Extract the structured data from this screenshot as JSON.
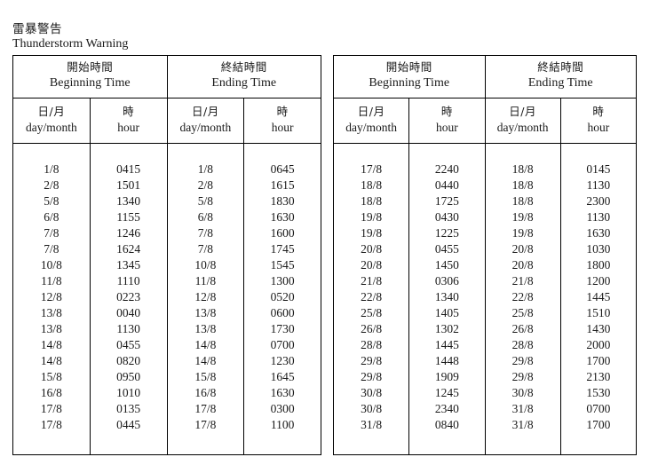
{
  "document": {
    "title_zh": "雷暴警告",
    "title_en": "Thunderstorm Warning"
  },
  "headers": {
    "beginning_zh": "開始時間",
    "beginning_en": "Beginning Time",
    "ending_zh": "終結時間",
    "ending_en": "Ending Time",
    "daymonth_zh": "日/月",
    "daymonth_en": "day/month",
    "hour_zh": "時",
    "hour_en": "hour"
  },
  "tables": [
    {
      "name": "left-table",
      "columns": [
        "begin_date",
        "begin_hour",
        "end_date",
        "end_hour"
      ],
      "rows": [
        {
          "begin_date": "1/8",
          "begin_hour": "0415",
          "end_date": "1/8",
          "end_hour": "0645"
        },
        {
          "begin_date": "2/8",
          "begin_hour": "1501",
          "end_date": "2/8",
          "end_hour": "1615"
        },
        {
          "begin_date": "5/8",
          "begin_hour": "1340",
          "end_date": "5/8",
          "end_hour": "1830"
        },
        {
          "begin_date": "6/8",
          "begin_hour": "1155",
          "end_date": "6/8",
          "end_hour": "1630"
        },
        {
          "begin_date": "7/8",
          "begin_hour": "1246",
          "end_date": "7/8",
          "end_hour": "1600"
        },
        {
          "begin_date": "7/8",
          "begin_hour": "1624",
          "end_date": "7/8",
          "end_hour": "1745"
        },
        {
          "begin_date": "10/8",
          "begin_hour": "1345",
          "end_date": "10/8",
          "end_hour": "1545"
        },
        {
          "begin_date": "11/8",
          "begin_hour": "1110",
          "end_date": "11/8",
          "end_hour": "1300"
        },
        {
          "begin_date": "12/8",
          "begin_hour": "0223",
          "end_date": "12/8",
          "end_hour": "0520"
        },
        {
          "begin_date": "13/8",
          "begin_hour": "0040",
          "end_date": "13/8",
          "end_hour": "0600"
        },
        {
          "begin_date": "13/8",
          "begin_hour": "1130",
          "end_date": "13/8",
          "end_hour": "1730"
        },
        {
          "begin_date": "14/8",
          "begin_hour": "0455",
          "end_date": "14/8",
          "end_hour": "0700"
        },
        {
          "begin_date": "14/8",
          "begin_hour": "0820",
          "end_date": "14/8",
          "end_hour": "1230"
        },
        {
          "begin_date": "15/8",
          "begin_hour": "0950",
          "end_date": "15/8",
          "end_hour": "1645"
        },
        {
          "begin_date": "16/8",
          "begin_hour": "1010",
          "end_date": "16/8",
          "end_hour": "1630"
        },
        {
          "begin_date": "17/8",
          "begin_hour": "0135",
          "end_date": "17/8",
          "end_hour": "0300"
        },
        {
          "begin_date": "17/8",
          "begin_hour": "0445",
          "end_date": "17/8",
          "end_hour": "1100"
        }
      ]
    },
    {
      "name": "right-table",
      "columns": [
        "begin_date",
        "begin_hour",
        "end_date",
        "end_hour"
      ],
      "rows": [
        {
          "begin_date": "17/8",
          "begin_hour": "2240",
          "end_date": "18/8",
          "end_hour": "0145"
        },
        {
          "begin_date": "18/8",
          "begin_hour": "0440",
          "end_date": "18/8",
          "end_hour": "1130"
        },
        {
          "begin_date": "18/8",
          "begin_hour": "1725",
          "end_date": "18/8",
          "end_hour": "2300"
        },
        {
          "begin_date": "19/8",
          "begin_hour": "0430",
          "end_date": "19/8",
          "end_hour": "1130"
        },
        {
          "begin_date": "19/8",
          "begin_hour": "1225",
          "end_date": "19/8",
          "end_hour": "1630"
        },
        {
          "begin_date": "20/8",
          "begin_hour": "0455",
          "end_date": "20/8",
          "end_hour": "1030"
        },
        {
          "begin_date": "20/8",
          "begin_hour": "1450",
          "end_date": "20/8",
          "end_hour": "1800"
        },
        {
          "begin_date": "21/8",
          "begin_hour": "0306",
          "end_date": "21/8",
          "end_hour": "1200"
        },
        {
          "begin_date": "22/8",
          "begin_hour": "1340",
          "end_date": "22/8",
          "end_hour": "1445"
        },
        {
          "begin_date": "25/8",
          "begin_hour": "1405",
          "end_date": "25/8",
          "end_hour": "1510"
        },
        {
          "begin_date": "26/8",
          "begin_hour": "1302",
          "end_date": "26/8",
          "end_hour": "1430"
        },
        {
          "begin_date": "28/8",
          "begin_hour": "1445",
          "end_date": "28/8",
          "end_hour": "2000"
        },
        {
          "begin_date": "29/8",
          "begin_hour": "1448",
          "end_date": "29/8",
          "end_hour": "1700"
        },
        {
          "begin_date": "29/8",
          "begin_hour": "1909",
          "end_date": "29/8",
          "end_hour": "2130"
        },
        {
          "begin_date": "30/8",
          "begin_hour": "1245",
          "end_date": "30/8",
          "end_hour": "1530"
        },
        {
          "begin_date": "30/8",
          "begin_hour": "2340",
          "end_date": "31/8",
          "end_hour": "0700"
        },
        {
          "begin_date": "31/8",
          "begin_hour": "0840",
          "end_date": "31/8",
          "end_hour": "1700"
        }
      ]
    }
  ]
}
